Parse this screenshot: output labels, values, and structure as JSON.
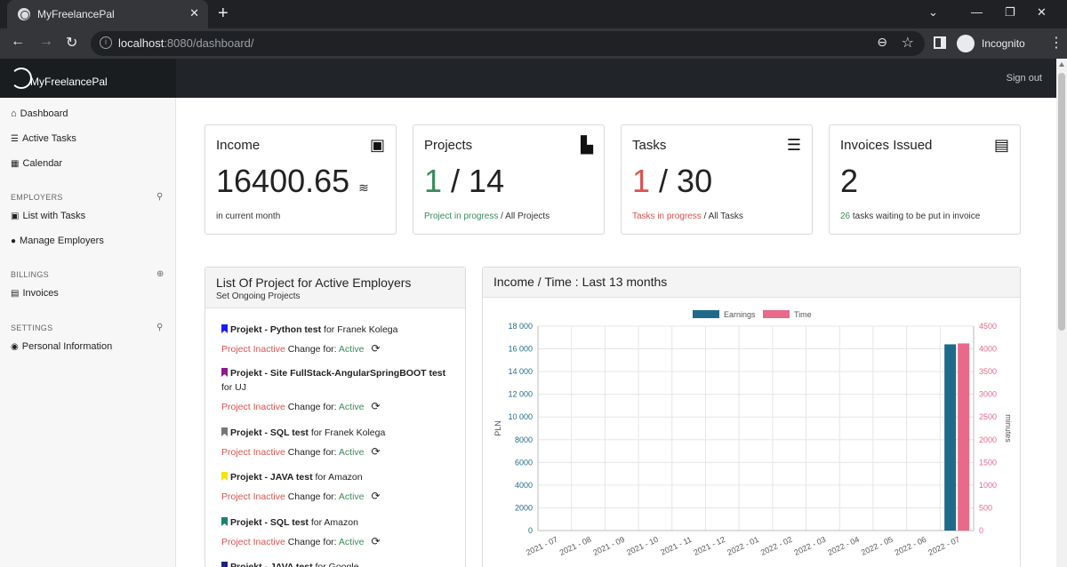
{
  "browser": {
    "tab_title": "MyFreelancePal",
    "url_host": "localhost",
    "url_path": ":8080/dashboard/",
    "profile_label": "Incognito"
  },
  "app": {
    "brand": "MyFreelancePal",
    "signout": "Sign out"
  },
  "sidebar": {
    "dashboard": "Dashboard",
    "active_tasks": "Active Tasks",
    "calendar": "Calendar",
    "employers_head": "EMPLOYERS",
    "list_with_tasks": "List with Tasks",
    "manage_employers": "Manage Employers",
    "billings_head": "BILLINGS",
    "invoices": "Invoices",
    "settings_head": "SETTINGS",
    "personal_info": "Personal Information"
  },
  "cards": {
    "income": {
      "title": "Income",
      "value": "16400.65",
      "sub": "in current month"
    },
    "projects": {
      "title": "Projects",
      "active": "1",
      "sep": " / ",
      "total": "14",
      "sub_green": "Project in progress",
      "sub_rest": " / All Projects"
    },
    "tasks": {
      "title": "Tasks",
      "active": "1",
      "sep": " / ",
      "total": "30",
      "sub_red": "Tasks in progress",
      "sub_rest": " / All Tasks"
    },
    "invoices": {
      "title": "Invoices Issued",
      "value": "2",
      "sub_num": "26",
      "sub_rest": " tasks waiting to be put in invoice"
    }
  },
  "projects_panel": {
    "title": "List Of Project for Active Employers",
    "subtitle": "Set Ongoing Projects",
    "status_label": "Project Inactive",
    "change_label": " Change for: ",
    "change_value": "Active",
    "items": [
      {
        "name": "Projekt - Python test",
        "for_text": " for Franek Kolega",
        "color": "#1a1aff"
      },
      {
        "name": "Projekt - Site FullStack-AngularSpringBOOT test",
        "for_text": " for UJ",
        "color": "#8b1a8b"
      },
      {
        "name": "Projekt - SQL test",
        "for_text": " for Franek Kolega",
        "color": "#777777"
      },
      {
        "name": "Projekt - JAVA test",
        "for_text": " for Amazon",
        "color": "#f5e400"
      },
      {
        "name": "Projekt - SQL test",
        "for_text": " for Amazon",
        "color": "#1f7f6f"
      },
      {
        "name": "Projekt - JAVA test",
        "for_text": " for Google",
        "color": "#1a237e"
      }
    ]
  },
  "chart_panel": {
    "title": "Income / Time : Last 13 months"
  },
  "chart_data": {
    "type": "bar",
    "categories": [
      "2021 - 07",
      "2021 - 08",
      "2021 - 09",
      "2021 - 10",
      "2021 - 11",
      "2021 - 12",
      "2022 - 01",
      "2022 - 02",
      "2022 - 03",
      "2022 - 04",
      "2022 - 05",
      "2022 - 06",
      "2022 - 07"
    ],
    "series": [
      {
        "name": "Earnings",
        "color": "#1f6a8a",
        "axis": "left",
        "values": [
          0,
          0,
          0,
          0,
          0,
          0,
          0,
          0,
          0,
          0,
          0,
          0,
          16400.65
        ]
      },
      {
        "name": "Time",
        "color": "#e8698a",
        "axis": "right",
        "values": [
          0,
          0,
          0,
          0,
          0,
          0,
          0,
          0,
          0,
          0,
          0,
          0,
          4120
        ]
      }
    ],
    "ylabel": "PLN",
    "y2label": "minutes",
    "ylim": [
      0,
      18000
    ],
    "y2lim": [
      0,
      4500
    ],
    "yticks": [
      "0",
      "2000",
      "4000",
      "6000",
      "8000",
      "10 000",
      "12 000",
      "14 000",
      "16 000",
      "18 000"
    ],
    "y2ticks": [
      "0",
      "500",
      "1000",
      "1500",
      "2000",
      "2500",
      "3000",
      "3500",
      "4000",
      "4500"
    ],
    "legend": "top",
    "grid": true
  }
}
